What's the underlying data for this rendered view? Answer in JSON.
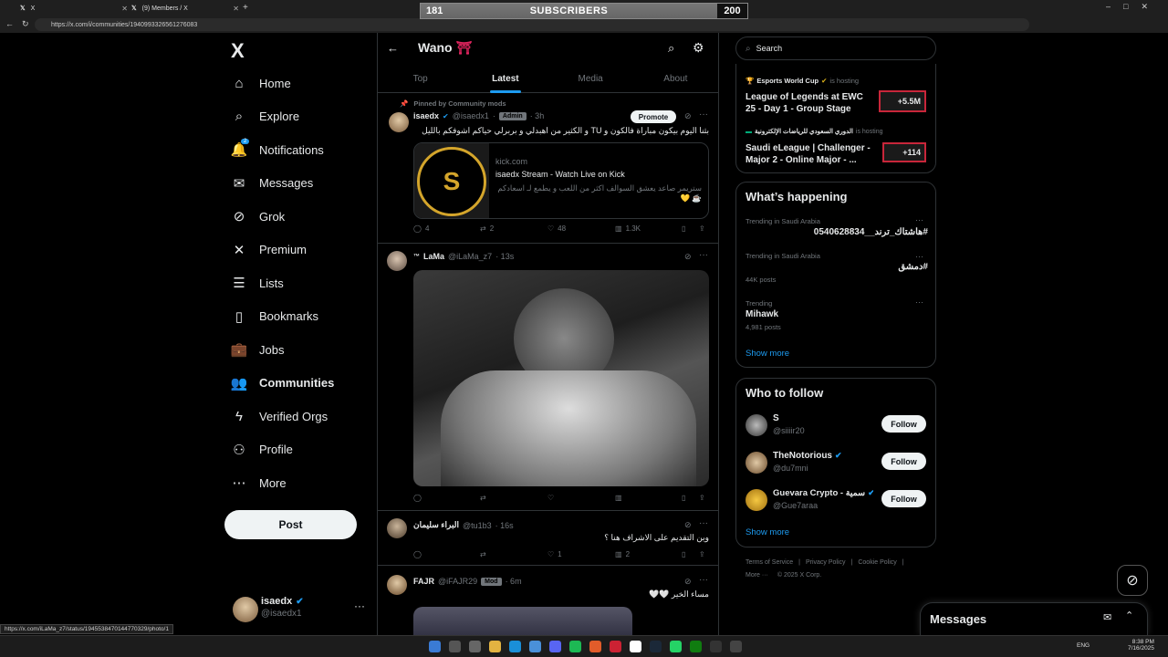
{
  "browser": {
    "tab1_title": "X",
    "tab2_title": "(9) Members / X",
    "url": "https://x.com/i/communities/1940993326561276083",
    "status_url": "https://x.com/iLaMa_z7/status/1945538470144770329/photo/1"
  },
  "subscriber_bar": {
    "current": "181",
    "label": "SUBSCRIBERS",
    "goal": "200",
    "progress": 0.905
  },
  "sidebar": {
    "logo": "X",
    "items": [
      {
        "label": "Home",
        "icon": "home-icon"
      },
      {
        "label": "Explore",
        "icon": "search-icon"
      },
      {
        "label": "Notifications",
        "icon": "bell-icon",
        "badge": "2"
      },
      {
        "label": "Messages",
        "icon": "envelope-icon"
      },
      {
        "label": "Grok",
        "icon": "grok-icon"
      },
      {
        "label": "Premium",
        "icon": "x-icon"
      },
      {
        "label": "Lists",
        "icon": "list-icon"
      },
      {
        "label": "Bookmarks",
        "icon": "bookmark-icon"
      },
      {
        "label": "Jobs",
        "icon": "briefcase-icon"
      },
      {
        "label": "Communities",
        "icon": "people-icon"
      },
      {
        "label": "Verified Orgs",
        "icon": "lightning-icon"
      },
      {
        "label": "Profile",
        "icon": "person-icon"
      },
      {
        "label": "More",
        "icon": "more-circle-icon"
      }
    ],
    "post_button": "Post",
    "account": {
      "name": "isaedx",
      "handle": "@isaedx1"
    }
  },
  "header": {
    "title": "Wano",
    "emoji": "⛩"
  },
  "tabs": [
    "Top",
    "Latest",
    "Media",
    "About"
  ],
  "posts": [
    {
      "pinned": "Pinned by Community mods",
      "name": "isaedx",
      "handle": "@isaedx1",
      "badge": "Admin",
      "time": "· 3h",
      "promote": "Promote",
      "text": "بثنا اليوم بيكون مباراة فالكون و TU و الكثير من اهبدلي و بربرلي حياكم اشوفكم بالليل",
      "card": {
        "domain": "kick.com",
        "title": "isaedx Stream - Watch Live on Kick",
        "desc": "ستريمر صاعد يعشق السوالف اكثر من اللعب و يطمع لـ اسعادكم ☕ 💛"
      },
      "replies": "4",
      "reposts": "2",
      "likes": "48",
      "views": "1.3K"
    },
    {
      "name": "LaMa",
      "prefix": "™",
      "handle": "@iLaMa_z7",
      "time": "· 13s"
    },
    {
      "name": "البراء سليمان",
      "handle": "@tu1b3",
      "time": "· 16s",
      "text": "وين التقديم على الاشراف هنا ؟",
      "likes": "1",
      "views": "2"
    },
    {
      "name": "FAJR",
      "handle": "@iFAJR29",
      "badge": "Mod",
      "time": "· 6m",
      "text": "مساء الخير 🤍🤍"
    }
  ],
  "right": {
    "search_placeholder": "Search",
    "events": [
      {
        "host": "Esports World Cup",
        "hosting": "is hosting",
        "title": "League of Legends at EWC 25 - Day 1 - Group Stage",
        "count": "+5.5M"
      },
      {
        "host": "الدوري السعودي للرياضات الإلكترونية",
        "hosting": "is hosting",
        "title": "Saudi eLeague | Challenger - Major 2 - Online Major - ...",
        "count": "+114"
      }
    ],
    "happening_title": "What’s happening",
    "trends": [
      {
        "label": "Trending in Saudi Arabia",
        "title": "#هاشتاك_ترند__0540628834",
        "posts": ""
      },
      {
        "label": "Trending in Saudi Arabia",
        "title": "#دمشق",
        "posts": "44K posts"
      },
      {
        "label": "Trending",
        "title": "Mihawk",
        "posts": "4,981 posts"
      }
    ],
    "show_more": "Show more",
    "follow_title": "Who to follow",
    "follows": [
      {
        "name": "S",
        "handle": "@siiiir20",
        "button": "Follow"
      },
      {
        "name": "TheNotorious",
        "handle": "@du7mni",
        "button": "Follow"
      },
      {
        "name": "Guevara Crypto - سمية",
        "handle": "@Gue7araa",
        "button": "Follow"
      }
    ],
    "footer": {
      "terms": "Terms of Service",
      "privacy": "Privacy Policy",
      "cookie": "Cookie Policy",
      "more": "More ···",
      "copy": "© 2025 X Corp."
    }
  },
  "messages_drawer": "Messages",
  "taskbar": {
    "lang": "ENG",
    "time": "8:38 PM",
    "date": "7/16/2025"
  },
  "colors": {
    "accent": "#1d9bf0",
    "bg": "#000000",
    "border": "#2f3336"
  }
}
